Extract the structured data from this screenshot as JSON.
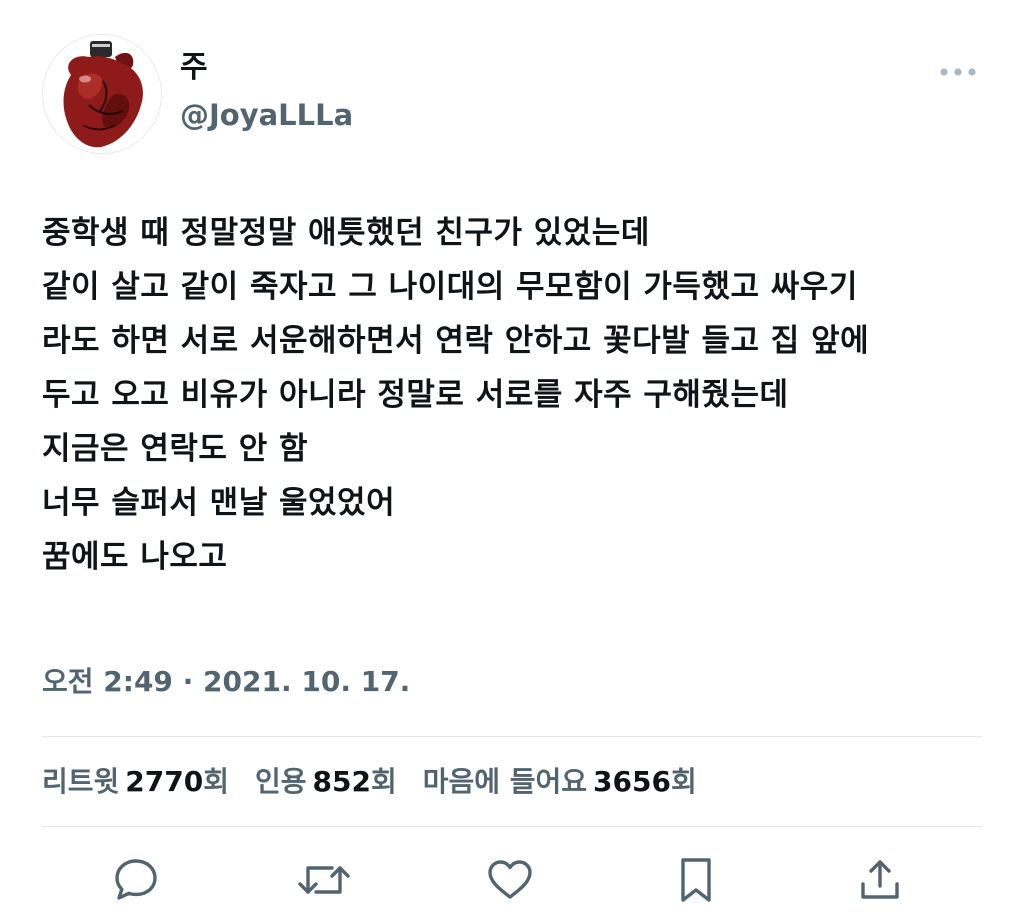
{
  "user": {
    "display_name": "주",
    "handle": "@JoyaLLLa",
    "avatar_icon": "anatomical-heart-vase-avatar"
  },
  "tweet": {
    "lines": [
      "중학생 때 정말정말 애틋했던 친구가 있었는데",
      "같이 살고 같이 죽자고 그 나이대의 무모함이 가득했고 싸우기",
      "라도 하면 서로 서운해하면서 연락 안하고 꽃다발 들고 집 앞에",
      "두고 오고 비유가 아니라 정말로 서로를 자주 구해줬는데",
      "지금은 연락도 안 함",
      "너무 슬퍼서 맨날 울었었어",
      "꿈에도 나오고"
    ],
    "timestamp": "오전 2:49 · 2021. 10. 17."
  },
  "stats": {
    "retweets": {
      "label": "리트윗",
      "count": "2770",
      "unit": "회"
    },
    "quotes": {
      "label": "인용",
      "count": "852",
      "unit": "회"
    },
    "likes": {
      "label": "마음에 들어요",
      "count": "3656",
      "unit": "회"
    }
  },
  "actions": [
    {
      "name": "reply",
      "icon": "speech-bubble-icon"
    },
    {
      "name": "retweet",
      "icon": "retweet-arrows-icon"
    },
    {
      "name": "like",
      "icon": "heart-icon"
    },
    {
      "name": "bookmark",
      "icon": "bookmark-icon"
    },
    {
      "name": "share",
      "icon": "share-upload-icon"
    }
  ],
  "colors": {
    "primary_text": "#0f1419",
    "secondary_text": "#536471",
    "divider": "#e4e8eb",
    "icon": "#536471",
    "background": "#ffffff"
  }
}
